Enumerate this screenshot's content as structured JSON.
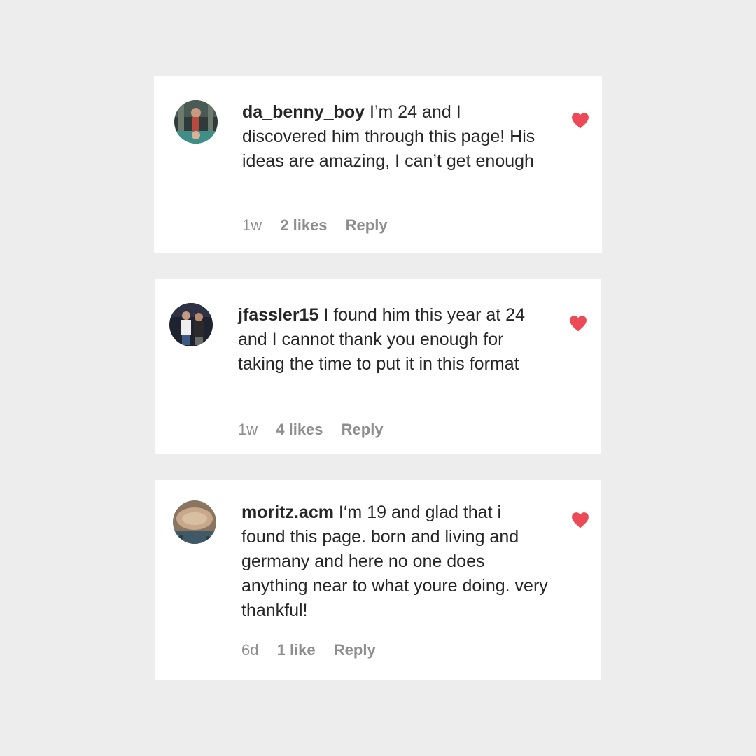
{
  "comments": [
    {
      "username": "da_benny_boy",
      "text": " I’m 24 and I discovered him through this page! His ideas are amazing, I can’t get enough",
      "time": "1w",
      "likes": "2 likes",
      "reply": "Reply",
      "liked": true
    },
    {
      "username": "jfassler15",
      "text": " I found him this year at 24 and I cannot thank you enough for taking the time to put it in this format",
      "time": "1w",
      "likes": "4 likes",
      "reply": "Reply",
      "liked": true
    },
    {
      "username": "moritz.acm",
      "text": " I‘m 19 and glad that i found this page. born and living and germany and here no one does anything near to what youre doing. very thankful!",
      "time": "6d",
      "likes": "1 like",
      "reply": "Reply",
      "liked": true
    }
  ],
  "colors": {
    "background": "#ededed",
    "card": "#ffffff",
    "text": "#262626",
    "meta": "#8e8e8e",
    "heart": "#ed4956"
  }
}
